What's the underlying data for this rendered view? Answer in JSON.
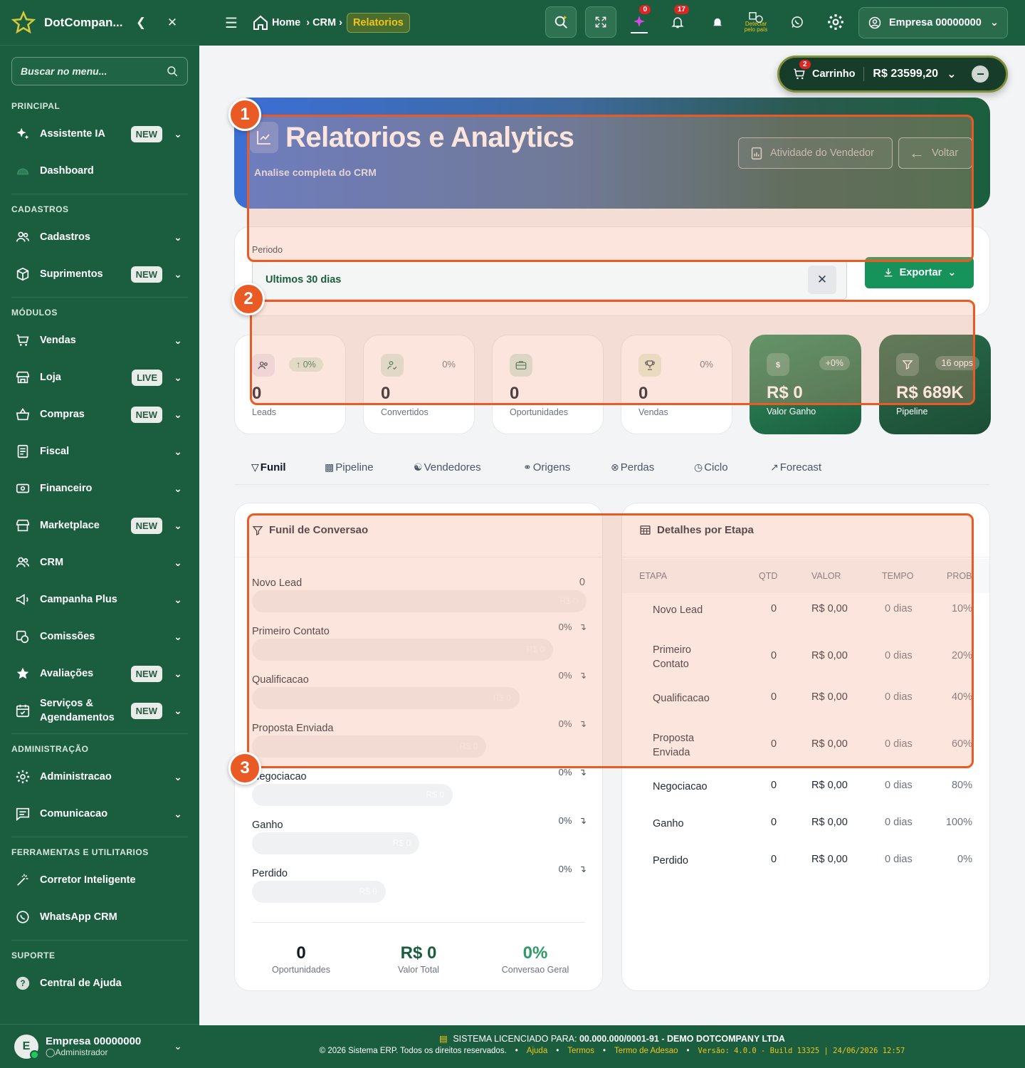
{
  "sidebar": {
    "brand": "DotCompan...",
    "search_placeholder": "Buscar no menu...",
    "sections": [
      {
        "title": "PRINCIPAL",
        "items": [
          {
            "label": "Assistente IA",
            "badge": "NEW",
            "icon": "sparkles-icon",
            "chevron": true
          },
          {
            "label": "Dashboard",
            "badge": "",
            "icon": "gauge-icon",
            "chevron": false
          }
        ]
      },
      {
        "title": "CADASTROS",
        "items": [
          {
            "label": "Cadastros",
            "badge": "",
            "icon": "users-icon",
            "chevron": true
          },
          {
            "label": "Suprimentos",
            "badge": "NEW",
            "icon": "box-icon",
            "chevron": true
          }
        ]
      },
      {
        "title": "MÓDULOS",
        "items": [
          {
            "label": "Vendas",
            "badge": "",
            "icon": "cart-icon",
            "chevron": true
          },
          {
            "label": "Loja",
            "badge": "LIVE",
            "icon": "store-icon",
            "chevron": true
          },
          {
            "label": "Compras",
            "badge": "NEW",
            "icon": "basket-icon",
            "chevron": true
          },
          {
            "label": "Fiscal",
            "badge": "",
            "icon": "document-icon",
            "chevron": true
          },
          {
            "label": "Financeiro",
            "badge": "",
            "icon": "money-icon",
            "chevron": true
          },
          {
            "label": "Marketplace",
            "badge": "NEW",
            "icon": "shop-icon",
            "chevron": true
          },
          {
            "label": "CRM",
            "badge": "",
            "icon": "users-icon",
            "chevron": true
          },
          {
            "label": "Campanha Plus",
            "badge": "",
            "icon": "megaphone-icon",
            "chevron": true
          },
          {
            "label": "Comissões",
            "badge": "",
            "icon": "commission-icon",
            "chevron": true
          },
          {
            "label": "Avaliações",
            "badge": "NEW",
            "icon": "star-icon",
            "chevron": true
          },
          {
            "label": "Serviços & Agendamentos",
            "badge": "NEW",
            "icon": "calendar-icon",
            "chevron": true
          }
        ]
      },
      {
        "title": "ADMINISTRAÇÃO",
        "items": [
          {
            "label": "Administracao",
            "badge": "",
            "icon": "gear-icon",
            "chevron": true
          },
          {
            "label": "Comunicacao",
            "badge": "",
            "icon": "message-icon",
            "chevron": true
          }
        ]
      },
      {
        "title": "FERRAMENTAS E UTILITARIOS",
        "items": [
          {
            "label": "Corretor Inteligente",
            "badge": "",
            "icon": "wand-icon",
            "chevron": false
          },
          {
            "label": "WhatsApp CRM",
            "badge": "",
            "icon": "whatsapp-icon",
            "chevron": false
          }
        ]
      },
      {
        "title": "SUPORTE",
        "items": [
          {
            "label": "Central de Ajuda",
            "badge": "",
            "icon": "help-icon",
            "chevron": false
          }
        ]
      }
    ],
    "footer": {
      "initial": "E",
      "name": "Empresa 00000000",
      "role": "Administrador"
    }
  },
  "topbar": {
    "breadcrumb": {
      "home": "Home",
      "crm": "CRM",
      "current": "Relatorios"
    },
    "ai_badge": "0",
    "notif_badge": "17",
    "geo_label": "Detectar pelo país",
    "company": "Empresa 00000000"
  },
  "cart": {
    "label": "Carrinho",
    "count": "2",
    "total": "R$ 23599,20"
  },
  "hero": {
    "title": "Relatorios e Analytics",
    "subtitle": "Analise completa do CRM",
    "btn_activity": "Atividade do Vendedor",
    "btn_back": "Voltar"
  },
  "filter": {
    "label": "Periodo",
    "value": "Ultimos 30 dias",
    "export": "Exportar"
  },
  "kpis": [
    {
      "value": "0",
      "label": "Leads",
      "pct": "0%",
      "icon": "users-icon",
      "trend": true
    },
    {
      "value": "0",
      "label": "Convertidos",
      "pct": "0%",
      "icon": "user-check-icon",
      "trend": false
    },
    {
      "value": "0",
      "label": "Oportunidades",
      "pct": "",
      "icon": "briefcase-icon",
      "trend": false
    },
    {
      "value": "0",
      "label": "Vendas",
      "pct": "0%",
      "icon": "trophy-icon",
      "trend": false
    },
    {
      "value": "R$ 0",
      "label": "Valor Ganho",
      "pct": "+0%",
      "icon": "dollar-icon",
      "trend": false
    },
    {
      "value": "R$ 689K",
      "label": "Pipeline",
      "pct": "16 opps",
      "icon": "filter-icon",
      "trend": false
    }
  ],
  "tabs": [
    "Funil",
    "Pipeline",
    "Vendedores",
    "Origens",
    "Perdas",
    "Ciclo",
    "Forecast"
  ],
  "funnel": {
    "title": "Funil de Conversao",
    "first_count": "0",
    "stages": [
      {
        "name": "Novo Lead",
        "value": "R$ 0",
        "pct": ""
      },
      {
        "name": "Primeiro Contato",
        "value": "R$ 0",
        "pct": "0%"
      },
      {
        "name": "Qualificacao",
        "value": "R$ 0",
        "pct": "0%"
      },
      {
        "name": "Proposta Enviada",
        "value": "R$ 0",
        "pct": "0%"
      },
      {
        "name": "Negociacao",
        "value": "R$ 0",
        "pct": "0%"
      },
      {
        "name": "Ganho",
        "value": "R$ 0",
        "pct": "0%"
      },
      {
        "name": "Perdido",
        "value": "R$ 0",
        "pct": "0%"
      }
    ],
    "summary": [
      {
        "value": "0",
        "label": "Oportunidades",
        "color": "#111827"
      },
      {
        "value": "R$ 0",
        "label": "Valor Total",
        "color": "#1b5e3f"
      },
      {
        "value": "0%",
        "label": "Conversao Geral",
        "color": "#2f9a67"
      }
    ]
  },
  "details": {
    "title": "Detalhes por Etapa",
    "headers": [
      "ETAPA",
      "QTD",
      "VALOR",
      "TEMPO",
      "PROB"
    ],
    "rows": [
      {
        "etapa": "Novo Lead",
        "qtd": "0",
        "valor": "R$ 0,00",
        "tempo": "0 dias",
        "prob": "10%"
      },
      {
        "etapa": "Primeiro Contato",
        "qtd": "0",
        "valor": "R$ 0,00",
        "tempo": "0 dias",
        "prob": "20%"
      },
      {
        "etapa": "Qualificacao",
        "qtd": "0",
        "valor": "R$ 0,00",
        "tempo": "0 dias",
        "prob": "40%"
      },
      {
        "etapa": "Proposta Enviada",
        "qtd": "0",
        "valor": "R$ 0,00",
        "tempo": "0 dias",
        "prob": "60%"
      },
      {
        "etapa": "Negociacao",
        "qtd": "0",
        "valor": "R$ 0,00",
        "tempo": "0 dias",
        "prob": "80%"
      },
      {
        "etapa": "Ganho",
        "qtd": "0",
        "valor": "R$ 0,00",
        "tempo": "0 dias",
        "prob": "100%"
      },
      {
        "etapa": "Perdido",
        "qtd": "0",
        "valor": "R$ 0,00",
        "tempo": "0 dias",
        "prob": "0%"
      }
    ]
  },
  "footer": {
    "license_prefix": "SISTEMA LICENCIADO PARA:",
    "license": "00.000.000/0001-91 - DEMO DOTCOMPANY LTDA",
    "copyright": "© 2026 Sistema ERP. Todos os direitos reservados.",
    "links": [
      "Ajuda",
      "Termos",
      "Termo de Adesao"
    ],
    "version": "Versão: 4.0.0 - Build 13325 | 24/06/2026 12:57"
  },
  "annotations": [
    "1",
    "2",
    "3"
  ],
  "colors": {
    "brand_green": "#1b5e3f",
    "accent_orange": "#ea5a24",
    "export_green": "#15935a",
    "gold": "#f0c419"
  }
}
